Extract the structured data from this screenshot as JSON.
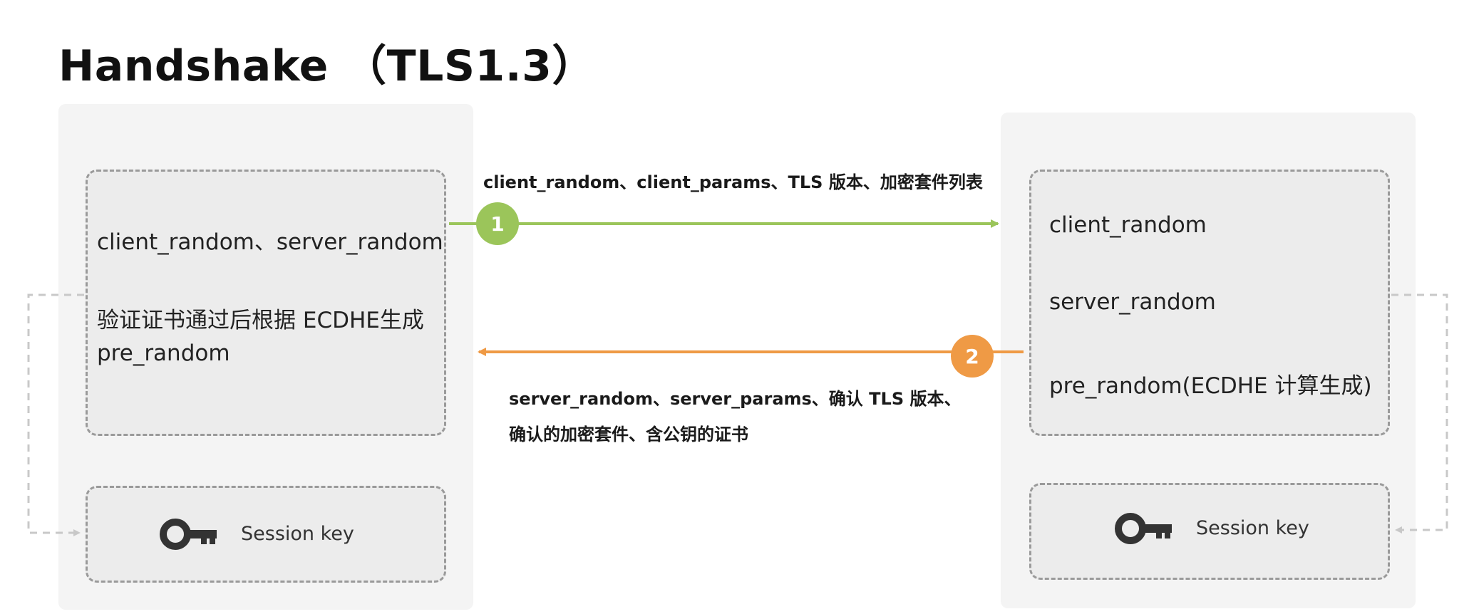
{
  "title": "Handshake （TLS1.3）",
  "client": {
    "line1": "client_random、server_random",
    "line2": "验证证书通过后根据 ECDHE生成",
    "line3": "pre_random",
    "session_key_label": "Session key"
  },
  "server": {
    "line1": "client_random",
    "line2": "server_random",
    "line3": "pre_random(ECDHE 计算生成)",
    "session_key_label": "Session key"
  },
  "messages": [
    {
      "step": "1",
      "direction": "client-to-server",
      "color": "#9bc55a",
      "text": "client_random、client_params、TLS 版本、加密套件列表"
    },
    {
      "step": "2",
      "direction": "server-to-client",
      "color": "#ef9a45",
      "text_line1": "server_random、server_params、确认 TLS 版本、",
      "text_line2": "确认的加密套件、含公钥的证书"
    }
  ],
  "icons": {
    "key": "key-icon"
  }
}
